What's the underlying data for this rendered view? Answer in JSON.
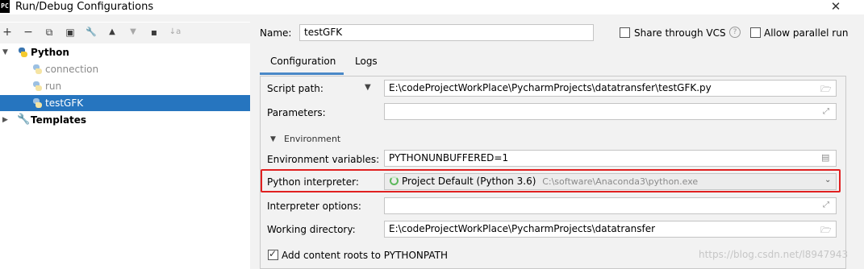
{
  "window": {
    "title": "Run/Debug Configurations",
    "app_icon": "PC"
  },
  "toolbar": {
    "add": "+",
    "remove": "−",
    "copy": "⧉",
    "save": "▣",
    "edit": "🔧",
    "up": "▲",
    "down": "▼",
    "folder": "▪",
    "sort": "↓a"
  },
  "tree": {
    "python_group": "Python",
    "items": [
      "connection",
      "run",
      "testGFK"
    ],
    "templates": "Templates"
  },
  "header": {
    "name_label": "Name:",
    "name_value": "testGFK",
    "share_vcs": "Share through VCS",
    "allow_parallel": "Allow parallel run"
  },
  "tabs": [
    "Configuration",
    "Logs"
  ],
  "form": {
    "script_path_label": "Script path:",
    "script_path_value": "E:\\codeProjectWorkPlace\\PycharmProjects\\datatransfer\\testGFK.py",
    "parameters_label": "Parameters:",
    "parameters_value": "",
    "environment_section": "Environment",
    "env_vars_label": "Environment variables:",
    "env_vars_value": "PYTHONUNBUFFERED=1",
    "interpreter_label": "Python interpreter:",
    "interpreter_value": "Project Default (Python 3.6)",
    "interpreter_path": "C:\\software\\Anaconda3\\python.exe",
    "interp_options_label": "Interpreter options:",
    "interp_options_value": "",
    "working_dir_label": "Working directory:",
    "working_dir_value": "E:\\codeProjectWorkPlace\\PycharmProjects\\datatransfer",
    "add_content_roots": "Add content roots to PYTHONPATH"
  },
  "watermark": "https://blog.csdn.net/l8947943",
  "colors": {
    "selection": "#2675bf",
    "highlight_box": "#e02020",
    "tab_underline": "#4a88c7"
  }
}
